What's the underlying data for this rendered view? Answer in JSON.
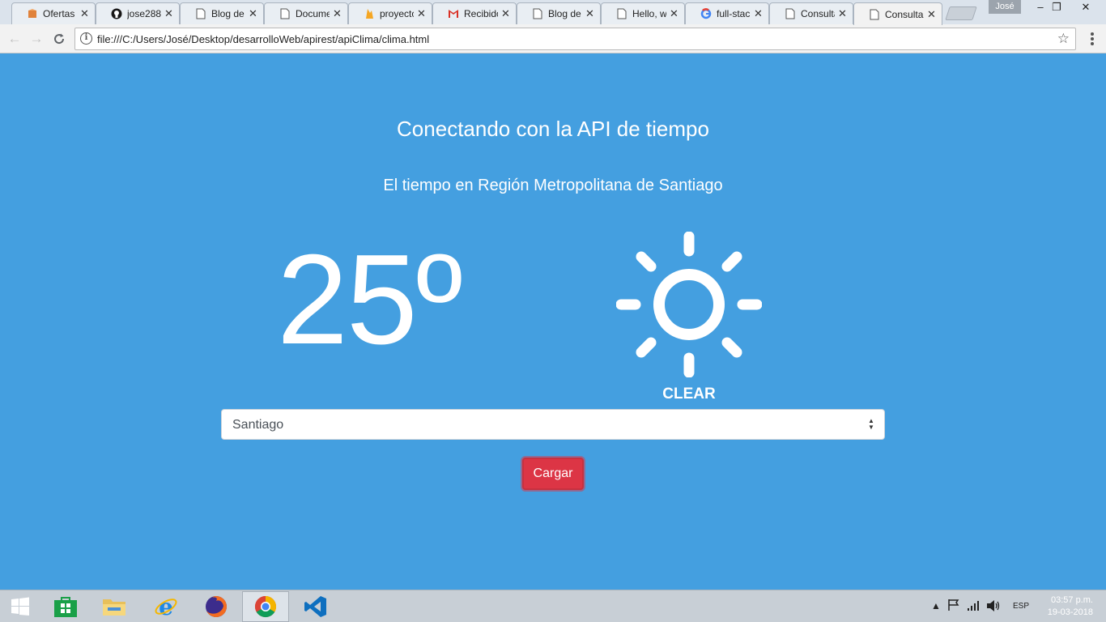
{
  "browser": {
    "tabs": [
      {
        "label": "Ofertas",
        "icon": "box-icon"
      },
      {
        "label": "jose288",
        "icon": "github-icon"
      },
      {
        "label": "Blog de",
        "icon": "page-icon"
      },
      {
        "label": "Docume",
        "icon": "page-icon"
      },
      {
        "label": "proyecto",
        "icon": "firebase-icon"
      },
      {
        "label": "Recibido",
        "icon": "gmail-icon"
      },
      {
        "label": "Blog de",
        "icon": "page-icon"
      },
      {
        "label": "Hello, w",
        "icon": "page-icon"
      },
      {
        "label": "full-stac",
        "icon": "google-icon"
      },
      {
        "label": "Consulta",
        "icon": "page-icon"
      },
      {
        "label": "Consulta",
        "icon": "page-icon"
      }
    ],
    "profile": "José",
    "url": "file:///C:/Users/José/Desktop/desarrolloWeb/apirest/apiClima/clima.html"
  },
  "page": {
    "title": "Conectando con la API de tiempo",
    "subtitle": "El tiempo en Región Metropolitana de Santiago",
    "temperature": "25º",
    "condition": "CLEAR",
    "condition_icon": "sun-icon",
    "select_value": "Santiago",
    "button_label": "Cargar",
    "colors": {
      "background": "#449fe0",
      "button": "#dc3545",
      "text": "#ffffff"
    }
  },
  "taskbar": {
    "apps": [
      "windows-start-icon",
      "store-icon",
      "file-explorer-icon",
      "internet-explorer-icon",
      "firefox-icon",
      "chrome-icon",
      "vscode-icon"
    ],
    "language": "ESP",
    "time": "03:57 p.m.",
    "date": "19-03-2018"
  }
}
